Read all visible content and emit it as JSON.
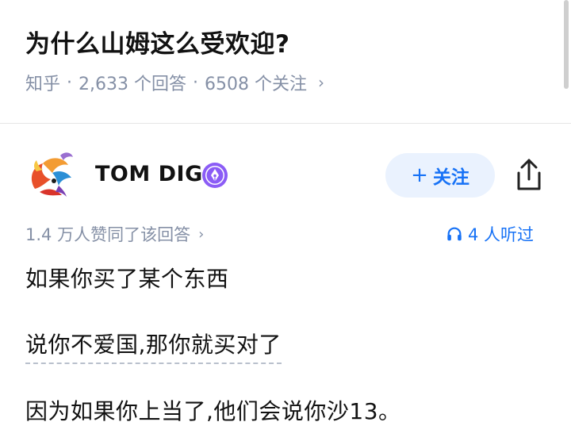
{
  "question": {
    "title": "为什么山姆这么受欢迎?",
    "source": "知乎",
    "answers_count": "2,633 个回答",
    "followers_count": "6508 个关注",
    "separator": "·",
    "chevron": "›"
  },
  "author": {
    "name": "TOM DIG",
    "follow_plus": "+",
    "follow_label": "关注",
    "badge_icon": "pen-nib-badge-icon",
    "share_icon": "share-icon"
  },
  "stats": {
    "approvals": "1.4 万人赞同了该回答",
    "chevron": "›",
    "listened": "4 人听过",
    "listened_icon": "headphones-icon"
  },
  "content": {
    "p1": "如果你买了某个东西",
    "p2": "说你不爱国,那你就买对了",
    "p3": "因为如果你上当了,他们会说你沙13。"
  },
  "colors": {
    "accent": "#1772f6",
    "meta": "#8590a6",
    "follow_bg": "#eaf2fe",
    "badge": "#8b5cf6"
  }
}
